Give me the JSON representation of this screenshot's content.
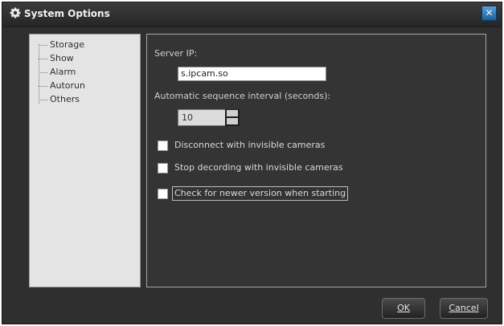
{
  "window": {
    "title": "System Options",
    "close_glyph": "✕",
    "title_icon": "gear-icon",
    "close_icon": "close-icon"
  },
  "nav": {
    "items": [
      {
        "label": "Storage",
        "selected": false
      },
      {
        "label": "Show",
        "selected": false
      },
      {
        "label": "Alarm",
        "selected": false
      },
      {
        "label": "Autorun",
        "selected": false
      },
      {
        "label": "Others",
        "selected": true
      }
    ]
  },
  "others": {
    "server_ip_label": "Server IP:",
    "server_ip_value": "s.ipcam.so",
    "sequence_label": "Automatic sequence interval (seconds):",
    "sequence_value": "10",
    "options": [
      {
        "label": "Disconnect with invisible cameras",
        "checked": false
      },
      {
        "label": "Stop decording with invisible cameras",
        "checked": false
      },
      {
        "label": "Check for newer version when starting",
        "checked": false
      }
    ]
  },
  "buttons": {
    "ok": "OK",
    "cancel": "Cancel"
  },
  "colors": {
    "window_bg": "#2f2f2f",
    "nav_bg": "#e4e4e4",
    "close_accent": "#1d5e9a"
  }
}
